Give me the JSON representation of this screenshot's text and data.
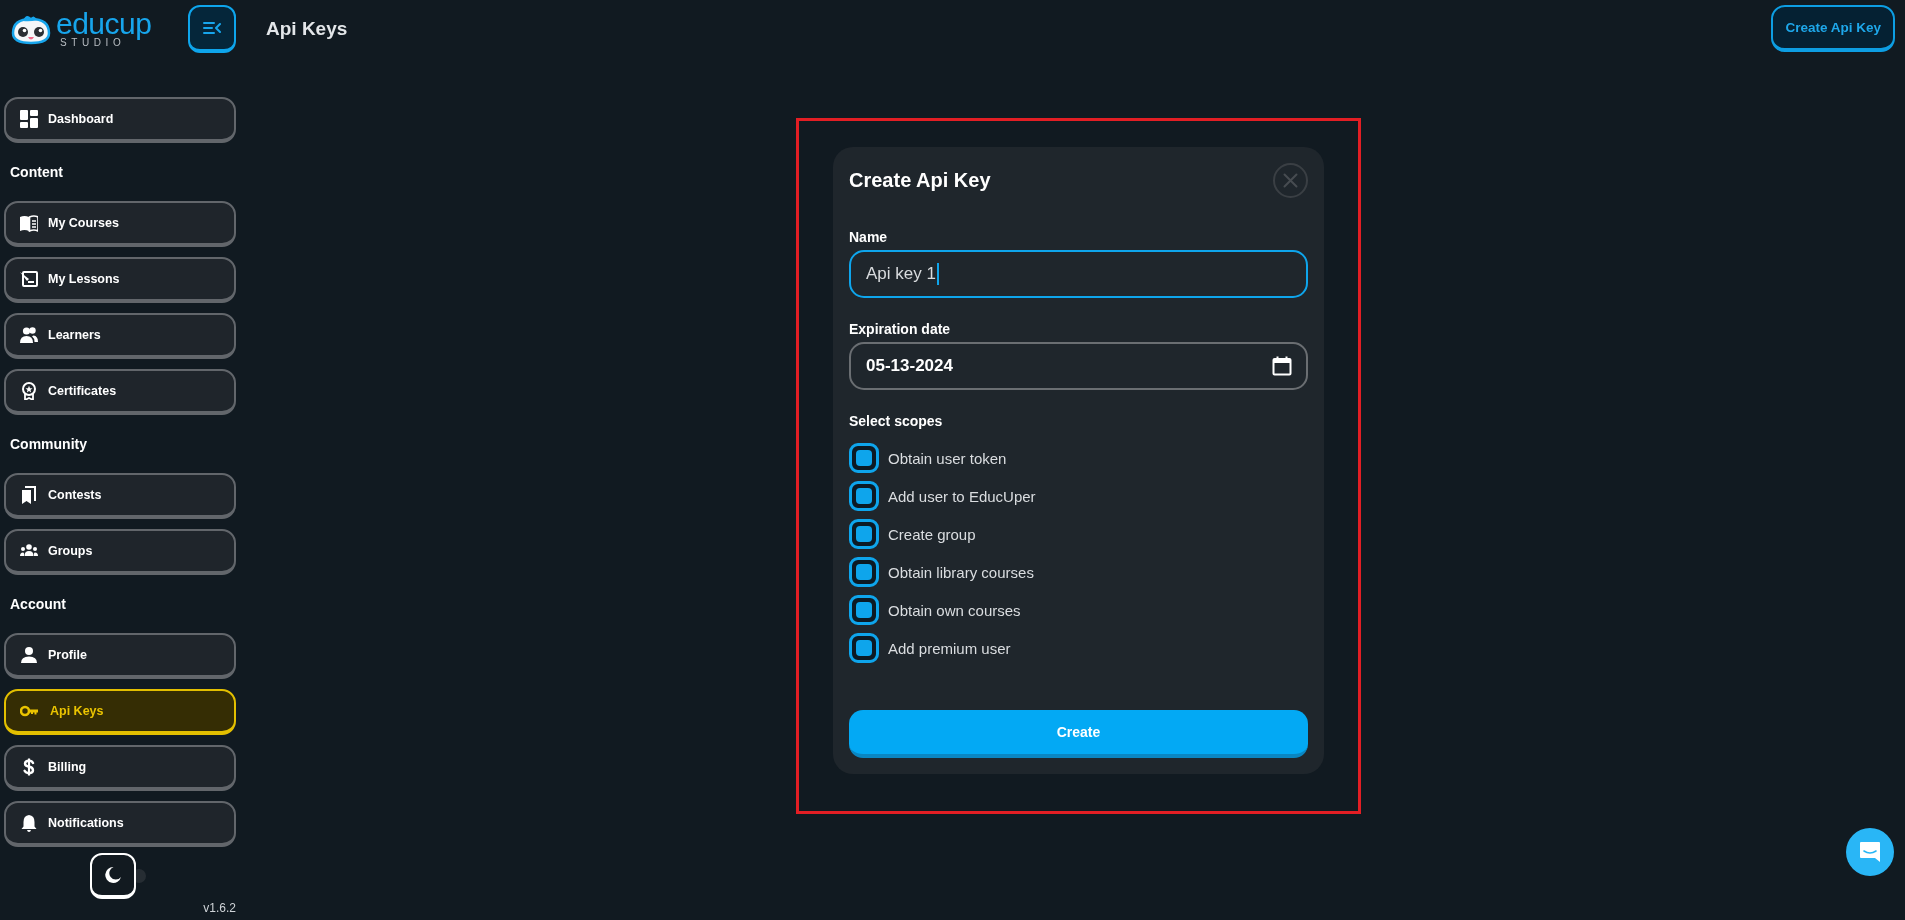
{
  "sidebar": {
    "logo": {
      "name": "educup",
      "subtitle": "STUDIO"
    },
    "sections": [
      {
        "items": [
          {
            "label": "Dashboard",
            "selected": false
          }
        ]
      },
      {
        "heading": "Content",
        "items": [
          {
            "label": "My Courses",
            "selected": false
          },
          {
            "label": "My Lessons",
            "selected": false
          },
          {
            "label": "Learners",
            "selected": false
          },
          {
            "label": "Certificates",
            "selected": false
          }
        ]
      },
      {
        "heading": "Community",
        "items": [
          {
            "label": "Contests",
            "selected": false
          },
          {
            "label": "Groups",
            "selected": false
          }
        ]
      },
      {
        "heading": "Account",
        "items": [
          {
            "label": "Profile",
            "selected": false
          },
          {
            "label": "Api Keys",
            "selected": true
          },
          {
            "label": "Billing",
            "selected": false
          },
          {
            "label": "Notifications",
            "selected": false
          }
        ]
      }
    ],
    "dark_mode": true,
    "version": "v1.6.2"
  },
  "header": {
    "title": "Api Keys",
    "action": "Create Api Key"
  },
  "dialog": {
    "title": "Create Api Key",
    "fields": [
      {
        "kind": "text",
        "label": "Name",
        "value": "Api key 1",
        "focused": true
      },
      {
        "kind": "date",
        "label": "Expiration date",
        "value": "05-13-2024",
        "focused": false
      }
    ],
    "scopes_label": "Select scopes",
    "scopes": [
      {
        "label": "Obtain user token",
        "checked": true
      },
      {
        "label": "Add user to EducUper",
        "checked": true
      },
      {
        "label": "Create group",
        "checked": true
      },
      {
        "label": "Obtain library courses",
        "checked": true
      },
      {
        "label": "Obtain own courses",
        "checked": true
      },
      {
        "label": "Add premium user",
        "checked": true
      }
    ],
    "submit": "Create"
  }
}
